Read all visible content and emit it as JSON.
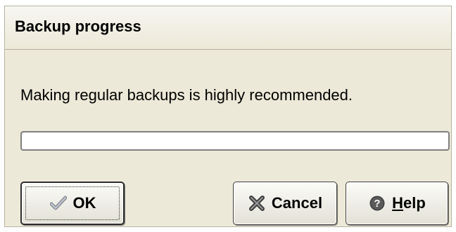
{
  "window": {
    "title": "Backup progress"
  },
  "message": "Making regular backups is highly recommended.",
  "progress": {
    "value_percent": 0
  },
  "buttons": {
    "ok_label": "OK",
    "ok_icon": "checkmark-icon",
    "cancel_label": "Cancel",
    "cancel_icon": "x-icon",
    "help_label_prefix": "H",
    "help_label_rest": "elp",
    "help_icon": "question-icon"
  },
  "colors": {
    "dialog_bg": "#ece9d8",
    "progress_fill": "#3a8f3a"
  }
}
